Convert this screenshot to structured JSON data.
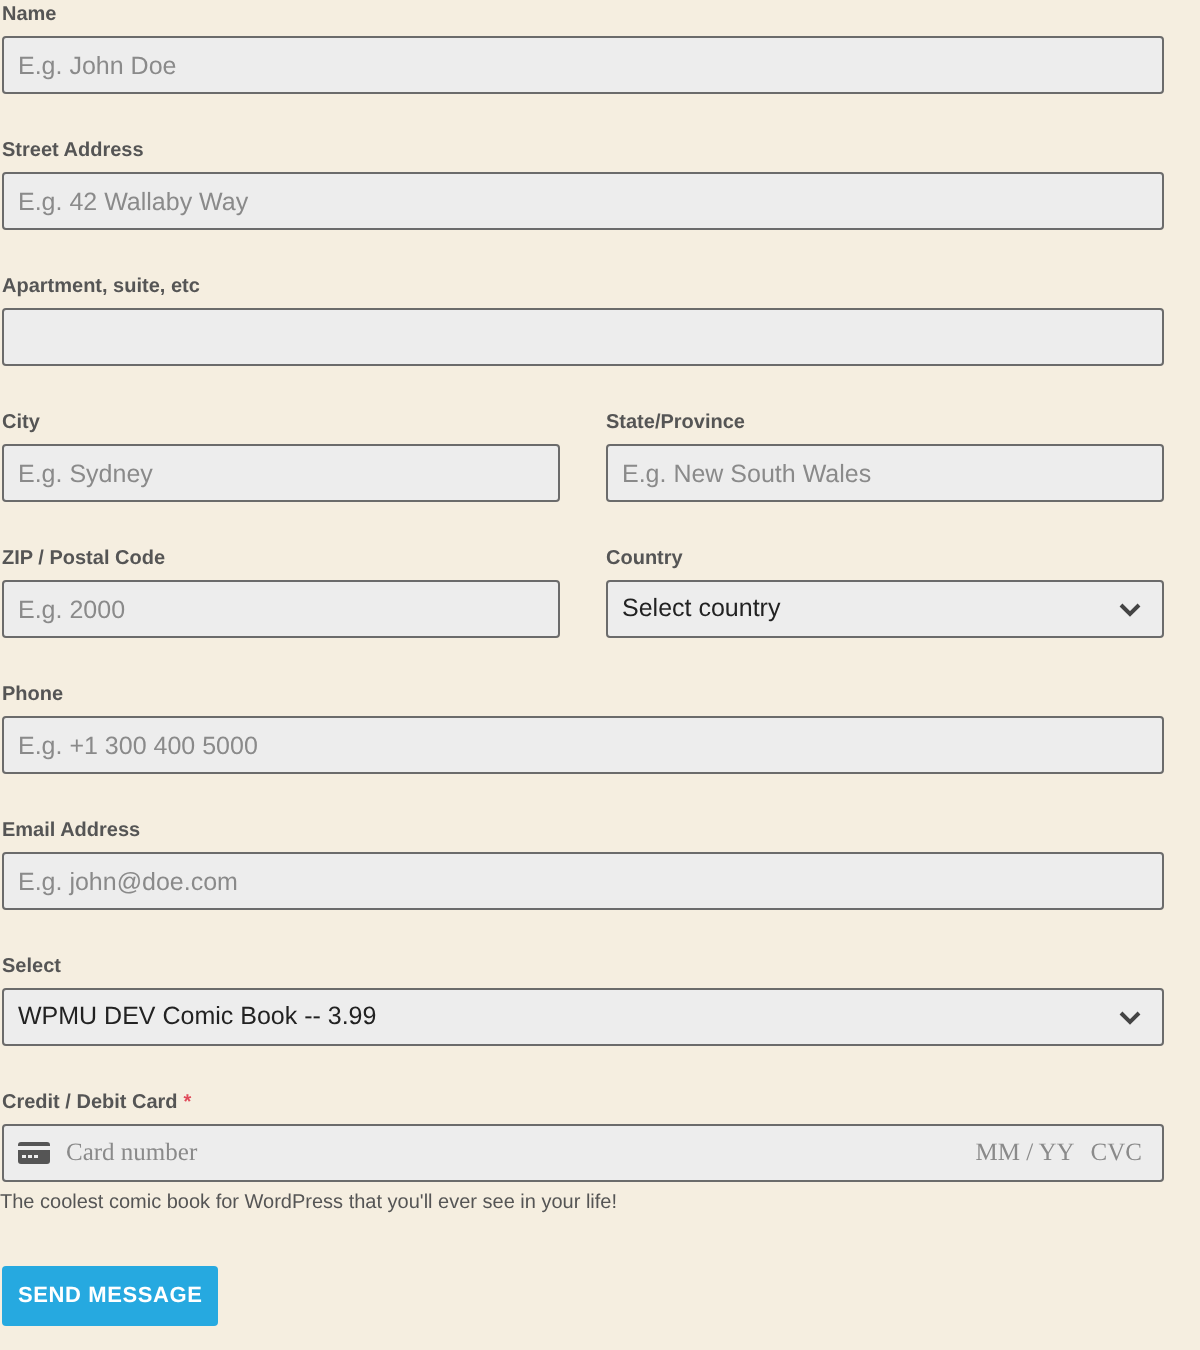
{
  "rows": [
    {
      "fields": [
        {
          "kind": "text",
          "label": "Name",
          "placeholder": "E.g. John Doe"
        }
      ]
    },
    {
      "fields": [
        {
          "kind": "text",
          "label": "Street Address",
          "placeholder": "E.g. 42 Wallaby Way"
        }
      ]
    },
    {
      "fields": [
        {
          "kind": "text",
          "label": "Apartment, suite, etc"
        }
      ]
    },
    {
      "fields": [
        {
          "kind": "text",
          "label": "City",
          "placeholder": "E.g. Sydney"
        },
        {
          "kind": "text",
          "label": "State/Province",
          "placeholder": "E.g. New South Wales"
        }
      ]
    },
    {
      "fields": [
        {
          "kind": "text",
          "label": "ZIP / Postal Code",
          "placeholder": "E.g. 2000"
        },
        {
          "kind": "select",
          "label": "Country",
          "value": "Select country"
        }
      ]
    },
    {
      "fields": [
        {
          "kind": "text",
          "label": "Phone",
          "placeholder": "E.g. +1 300 400 5000"
        }
      ]
    },
    {
      "fields": [
        {
          "kind": "text",
          "label": "Email Address",
          "placeholder": "E.g. john@doe.com"
        }
      ]
    },
    {
      "fields": [
        {
          "kind": "select",
          "label": "Select",
          "value": "WPMU DEV Comic Book -- 3.99"
        }
      ]
    },
    {
      "fields": [
        {
          "kind": "card",
          "label": "Credit / Debit Card",
          "asterisk": "*",
          "placeholder": "Card number",
          "expiry_placeholder": "MM / YY",
          "cvc_placeholder": "CVC"
        }
      ]
    }
  ],
  "description": "The coolest comic book for WordPress that you'll ever see in your life!",
  "submit_button": "SEND MESSAGE"
}
